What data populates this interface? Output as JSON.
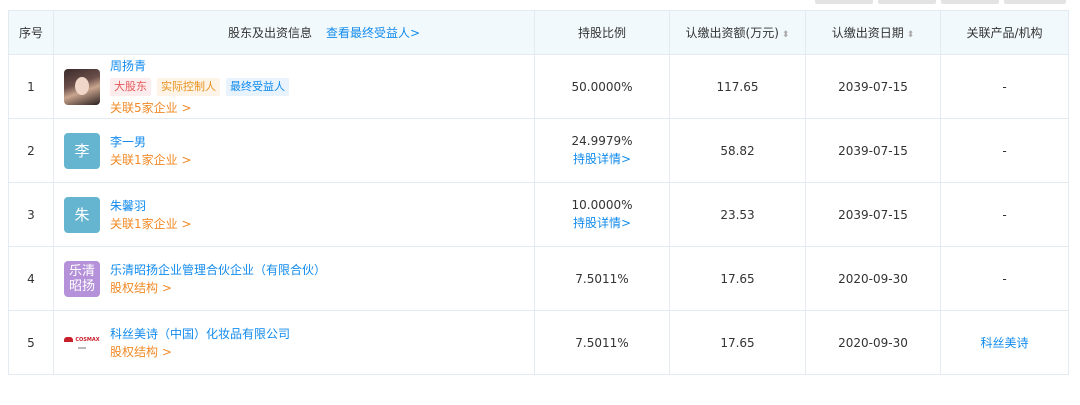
{
  "header": {
    "index": "序号",
    "holder": "股东及出资信息",
    "holder_link": "查看最终受益人>",
    "ratio": "持股比例",
    "amount": "认缴出资额(万元)",
    "date": "认缴出资日期",
    "related": "关联产品/机构",
    "sort_icon": "⬍"
  },
  "rows": [
    {
      "index": "1",
      "name": "周扬青",
      "avatar_type": "photo",
      "tags": [
        "大股东",
        "实际控制人",
        "最终受益人"
      ],
      "link": "关联5家企业 >",
      "ratio": "50.0000%",
      "ratio_detail": "",
      "amount": "117.65",
      "date": "2039-07-15",
      "related": "-"
    },
    {
      "index": "2",
      "name": "李一男",
      "avatar_type": "text",
      "avatar_text": "李",
      "link": "关联1家企业 >",
      "ratio": "24.9979%",
      "ratio_detail": "持股详情>",
      "amount": "58.82",
      "date": "2039-07-15",
      "related": "-"
    },
    {
      "index": "3",
      "name": "朱馨羽",
      "avatar_type": "text",
      "avatar_text": "朱",
      "link": "关联1家企业 >",
      "ratio": "10.0000%",
      "ratio_detail": "持股详情>",
      "amount": "23.53",
      "date": "2039-07-15",
      "related": "-"
    },
    {
      "index": "4",
      "name": "乐清昭扬企业管理合伙企业（有限合伙）",
      "avatar_type": "text2",
      "avatar_line1": "乐清",
      "avatar_line2": "昭扬",
      "link": "股权结构 >",
      "ratio": "7.5011%",
      "ratio_detail": "",
      "amount": "17.65",
      "date": "2020-09-30",
      "related": "-"
    },
    {
      "index": "5",
      "name": "科丝美诗（中国）化妆品有限公司",
      "avatar_type": "logo",
      "avatar_logo_text": "COSMAX",
      "link": "股权结构 >",
      "ratio": "7.5011%",
      "ratio_detail": "",
      "amount": "17.65",
      "date": "2020-09-30",
      "related": "科丝美诗"
    }
  ],
  "colors": {
    "link_blue": "#128bed",
    "link_orange": "#f08a26",
    "header_bg": "#f2f9fc",
    "avatar_teal": "#66b5d0",
    "avatar_purple": "#b591d9"
  }
}
